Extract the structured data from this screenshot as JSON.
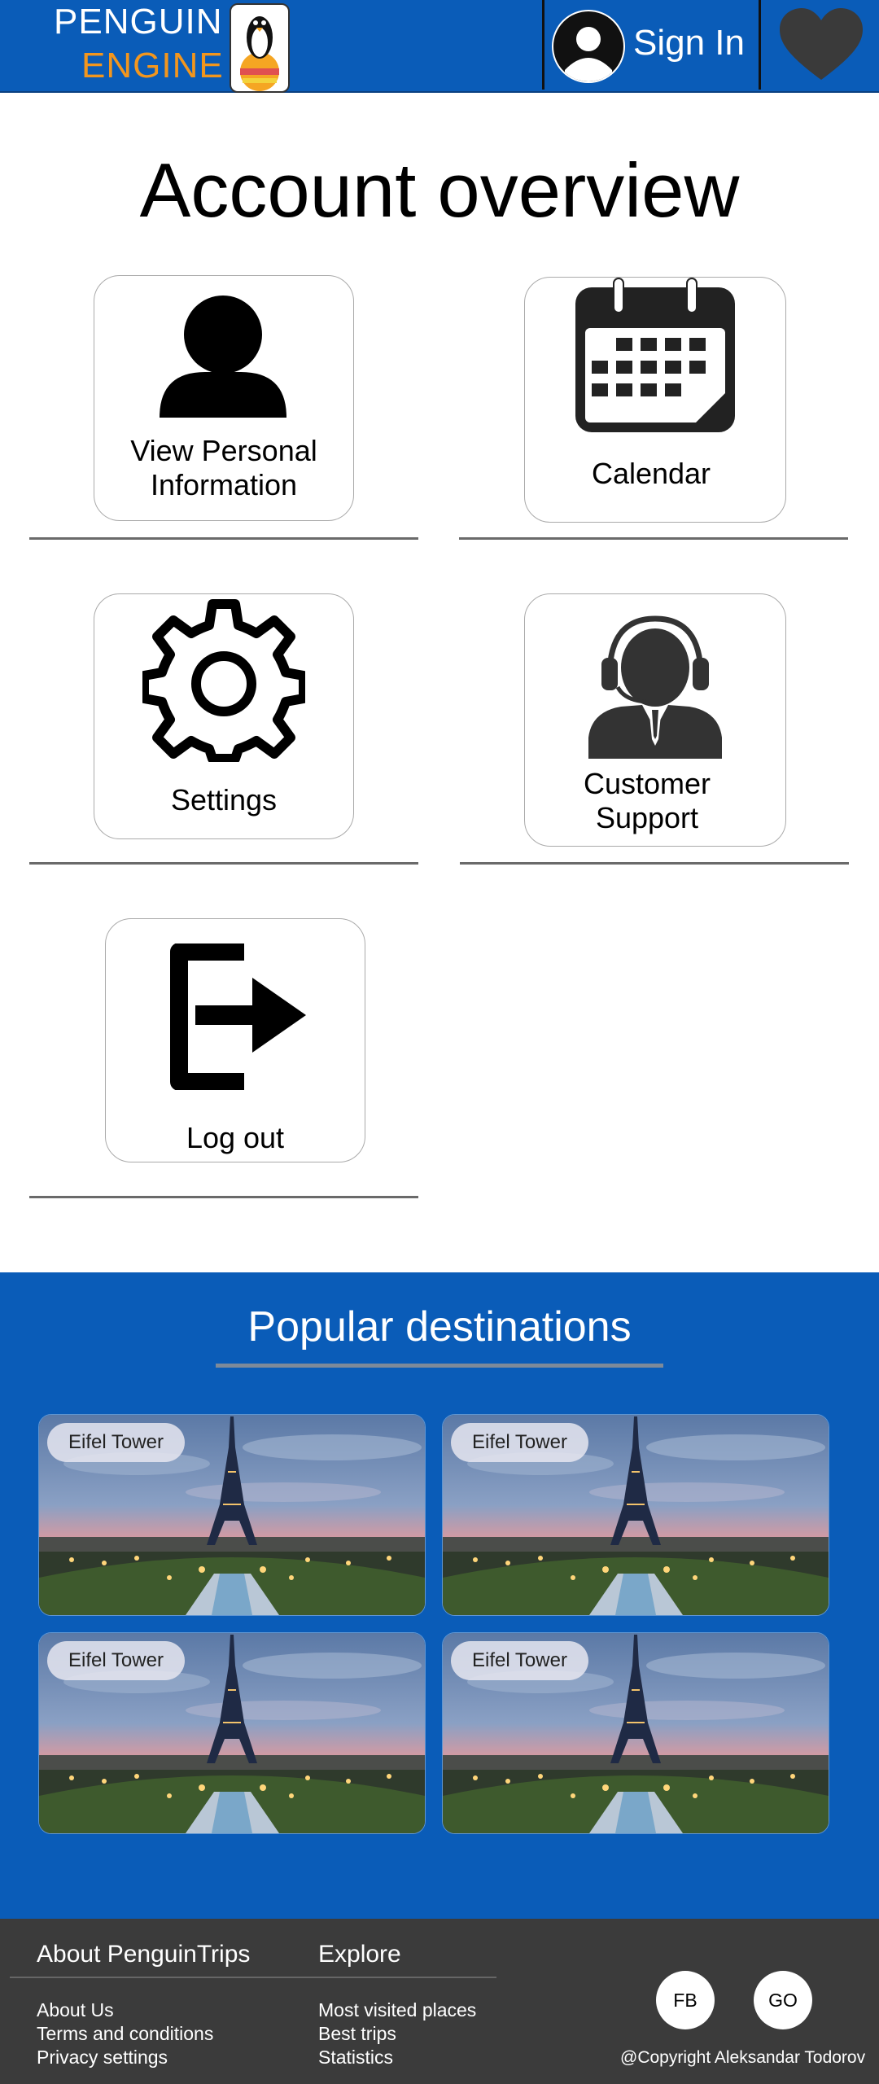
{
  "header": {
    "logo_line1": "PENGUIN",
    "logo_line2": "ENGINE",
    "sign_in_label": "Sign In"
  },
  "page_title": "Account overview",
  "account_cards": [
    {
      "label_line1": "View Personal",
      "label_line2": "Information",
      "icon": "user-icon"
    },
    {
      "label": "Calendar",
      "icon": "calendar-icon"
    },
    {
      "label": "Settings",
      "icon": "gear-icon"
    },
    {
      "label_line1": "Customer",
      "label_line2": "Support",
      "icon": "headset-agent-icon"
    },
    {
      "label": "Log out",
      "icon": "logout-icon"
    }
  ],
  "destinations": {
    "title": "Popular destinations",
    "items": [
      {
        "label": "Eifel Tower"
      },
      {
        "label": "Eifel Tower"
      },
      {
        "label": "Eifel Tower"
      },
      {
        "label": "Eifel Tower"
      }
    ]
  },
  "footer": {
    "about_heading": "About PenguinTrips",
    "about_links": [
      "About Us",
      "Terms and conditions",
      "Privacy settings"
    ],
    "explore_heading": "Explore",
    "explore_links": [
      "Most visited places",
      "Best trips",
      "Statistics"
    ],
    "social": [
      "FB",
      "GO"
    ],
    "copyright": "@Copyright Aleksandar Todorov"
  },
  "colors": {
    "brand_blue": "#0a5cb8",
    "logo_orange": "#f2961e",
    "footer_bg": "#3b3b3b"
  }
}
